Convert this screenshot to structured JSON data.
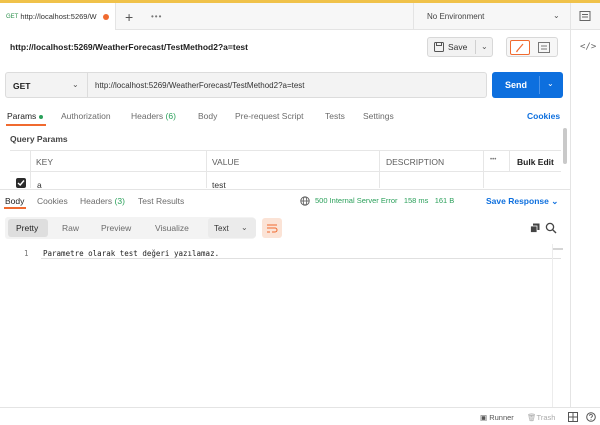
{
  "tab": {
    "method": "GET",
    "title": "http://localhost:5269/W"
  },
  "environment": {
    "label": "No Environment"
  },
  "request": {
    "name": "http://localhost:5269/WeatherForecast/TestMethod2?a=test",
    "save_label": "Save",
    "method": "GET",
    "url": "http://localhost:5269/WeatherForecast/TestMethod2?a=test",
    "send_label": "Send"
  },
  "request_tabs": [
    {
      "label": "Params"
    },
    {
      "label": "Authorization"
    },
    {
      "label": "Headers",
      "count": "(6)"
    },
    {
      "label": "Body"
    },
    {
      "label": "Pre-request Script"
    },
    {
      "label": "Tests"
    },
    {
      "label": "Settings"
    }
  ],
  "cookies_link": "Cookies",
  "query_params": {
    "title": "Query Params",
    "headers": {
      "key": "KEY",
      "value": "VALUE",
      "description": "DESCRIPTION",
      "more": "•••",
      "bulk": "Bulk Edit"
    },
    "rows": [
      {
        "key": "a",
        "value": "test",
        "description": "",
        "checked": true
      }
    ]
  },
  "response": {
    "tabs": [
      {
        "label": "Body"
      },
      {
        "label": "Cookies"
      },
      {
        "label": "Headers",
        "count": "(3)"
      },
      {
        "label": "Test Results"
      }
    ],
    "status": "500 Internal Server Error",
    "time": "158 ms",
    "size": "161 B",
    "save_label": "Save Response",
    "formats": [
      "Pretty",
      "Raw",
      "Preview",
      "Visualize"
    ],
    "text_type": "Text",
    "lines": [
      {
        "number": "1",
        "text": "Parametre olarak test değeri yazılamaz."
      }
    ]
  },
  "footer": {
    "runner": "Runner",
    "trash": "Trash"
  },
  "colors": {
    "accent": "#f06a2f",
    "primary": "#0d6fde",
    "success": "#2aa05a",
    "brand_bar": "#f0c24a"
  }
}
